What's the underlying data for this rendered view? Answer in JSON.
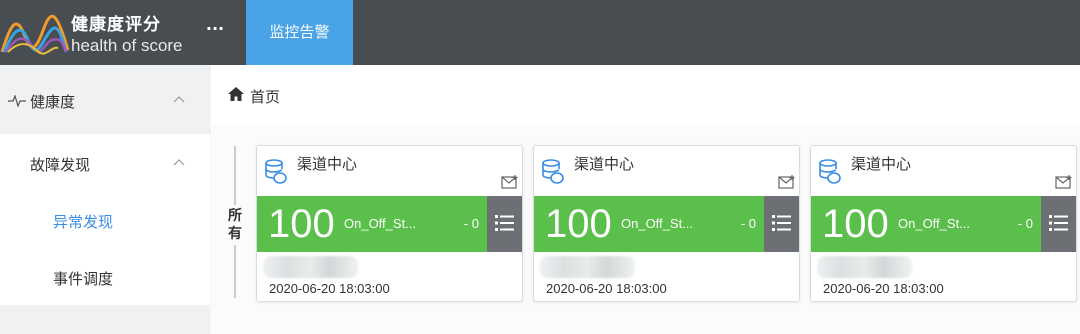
{
  "header": {
    "title": "健康度评分",
    "subtitle": "health of score",
    "more_label": "···",
    "tabs": [
      {
        "label": "监控告警",
        "active": true
      }
    ],
    "colors": {
      "bar": "#484d52",
      "active_tab": "#4aa3e6"
    }
  },
  "sidebar": {
    "items": [
      {
        "label": "健康度",
        "icon": "pulse-icon",
        "expanded": true
      },
      {
        "label": "故障发现",
        "expanded": true
      },
      {
        "label": "异常发现",
        "selected": true
      },
      {
        "label": "事件调度"
      }
    ]
  },
  "breadcrumb": {
    "home_icon": "home-icon",
    "label": "首页"
  },
  "group": {
    "label": "所有"
  },
  "cards": [
    {
      "title": "渠道中心",
      "score": "100",
      "metric": "On_Off_St...",
      "count": "- 0",
      "timestamp": "2020-06-20 18:03:00"
    },
    {
      "title": "渠道中心",
      "score": "100",
      "metric": "On_Off_St...",
      "count": "- 0",
      "timestamp": "2020-06-20 18:03:00"
    },
    {
      "title": "渠道中心",
      "score": "100",
      "metric": "On_Off_St...",
      "count": "- 0",
      "timestamp": "2020-06-20 18:03:00"
    }
  ],
  "colors": {
    "status_ok": "#5bbf4b",
    "accent": "#3a8ee6",
    "list_button": "#6c6f73"
  }
}
